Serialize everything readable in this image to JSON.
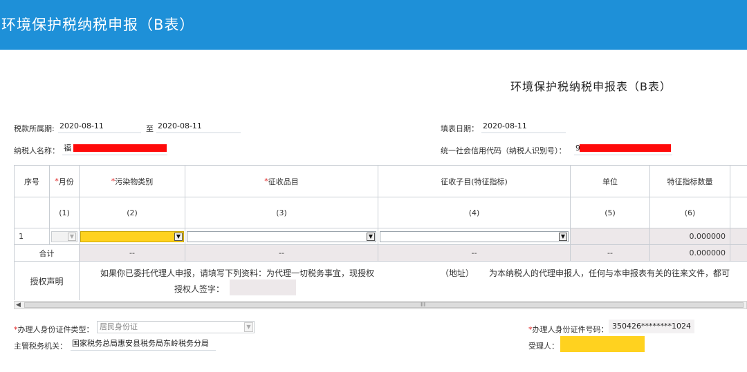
{
  "header": {
    "title": "环境保护税纳税申报（B表）"
  },
  "form": {
    "title": "环境保护税纳税申报表（B表）",
    "period_label": "税款所属期:",
    "period_start": "2020-08-11",
    "period_to": "至",
    "period_end": "2020-08-11",
    "fill_date_label": "填表日期：",
    "fill_date": "2020-08-11",
    "taxpayer_name_label": "纳税人名称：",
    "taxpayer_name_visible": "福",
    "credit_code_label": "统一社会信用代码（纳税人识别号）：",
    "credit_code_visible": "9"
  },
  "table": {
    "headers": [
      {
        "req": "",
        "text": "序号"
      },
      {
        "req": "*",
        "text": "月份"
      },
      {
        "req": "*",
        "text": "污染物类别"
      },
      {
        "req": "*",
        "text": "征收品目"
      },
      {
        "req": "",
        "text": "征收子目(特征指标)"
      },
      {
        "req": "",
        "text": "单位"
      },
      {
        "req": "",
        "text": "特征指标数量"
      }
    ],
    "col_numbers": [
      "",
      "(1)",
      "(2)",
      "(3)",
      "(4)",
      "(5)",
      "(6)"
    ],
    "row1": {
      "seq": "1",
      "quantity": "0.000000"
    },
    "total": {
      "label": "合计",
      "c2": "--",
      "c3": "--",
      "c4": "--",
      "c5": "--",
      "quantity": "0.000000"
    },
    "auth": {
      "label": "授权声明",
      "line1a": "如果你已委托代理人申报，请填写下列资料：为代理一切税务事宜，现授权",
      "line1b": "（地址）",
      "line1c": "为本纳税人的代理申报人，任何与本申报表有关的往来文件，都可",
      "sign_label": "授权人签字："
    }
  },
  "scrollbar": {
    "left_arrow": "◀",
    "grip": "III"
  },
  "footer": {
    "id_type_label": "办理人身份证件类型：",
    "id_type_value": "居民身份证",
    "id_number_label": "办理人身份证件号码：",
    "id_number_value": "350426********1024",
    "tax_office_label": "主管税务机关：",
    "tax_office_value": "国家税务总局惠安县税务局东岭税务分局",
    "receiver_label": "受理人："
  },
  "colors": {
    "header_bg": "#1e90d8",
    "required": "#e02020",
    "highlight": "#ffd21f",
    "redaction": "#ff0a0a"
  }
}
